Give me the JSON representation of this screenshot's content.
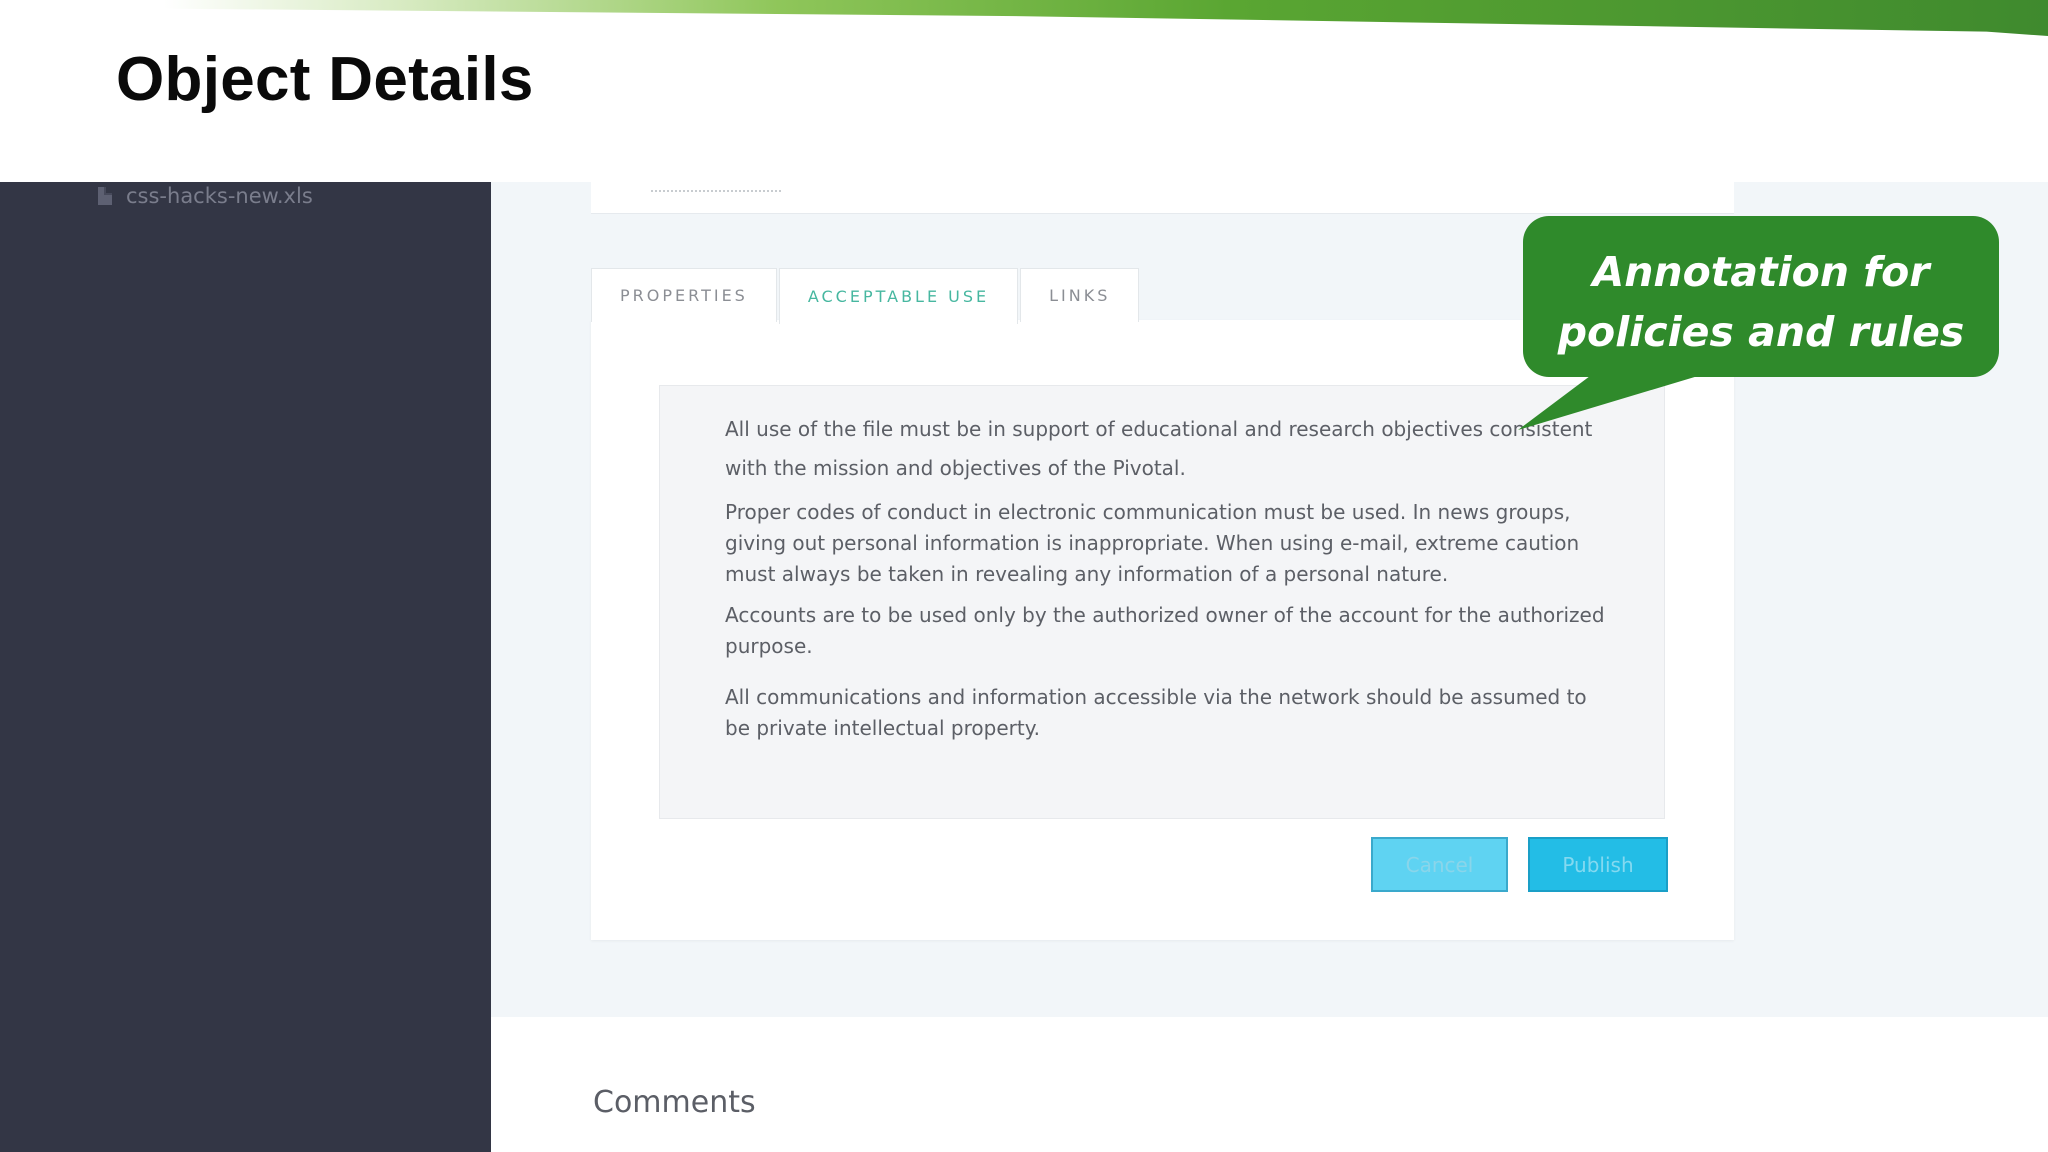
{
  "slide": {
    "title": "Object Details"
  },
  "sidebar": {
    "file_name": "css-hacks-new.xls",
    "file_icon": "file-icon"
  },
  "tabs": [
    {
      "label": "PROPERTIES",
      "active": false
    },
    {
      "label": "ACCEPTABLE USE",
      "active": true
    },
    {
      "label": "LINKS",
      "active": false
    }
  ],
  "policy": {
    "paragraphs": [
      "All use of the file must be in support of educational and research objectives consistent with the mission and objectives of the Pivotal.",
      "Proper codes of conduct in electronic communication must be used. In news groups, giving out personal information is inappropriate. When using e-mail, extreme caution must always be taken in revealing any information of a personal nature.",
      "Accounts are to be used only by the authorized owner of the account for the authorized purpose.",
      "All communications and information accessible via the network should be assumed to be private intellectual property."
    ]
  },
  "buttons": {
    "cancel_label": "Cancel",
    "publish_label": "Publish"
  },
  "comments": {
    "title": "Comments"
  },
  "callout": {
    "line1": "Annotation for",
    "line2": "policies and rules"
  },
  "colors": {
    "sidebar": "#333645",
    "accent_green": "#2f8a2b",
    "active_tab": "#47b7a0",
    "publish": "#23bde6",
    "cancel": "#5fd3f2"
  }
}
